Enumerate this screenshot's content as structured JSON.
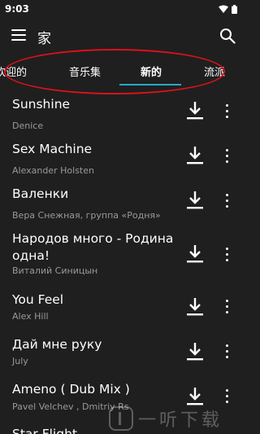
{
  "status_bar": {
    "time": "9:03"
  },
  "app_bar": {
    "title": "家"
  },
  "tabs": [
    {
      "label": "欢迎的"
    },
    {
      "label": "音乐集"
    },
    {
      "label": "新的"
    },
    {
      "label": "流派"
    }
  ],
  "active_tab": "新的",
  "songs": [
    {
      "title": "Sunshine",
      "artist": "Denice"
    },
    {
      "title": "Sex Machine",
      "artist": "Alexander Holsten"
    },
    {
      "title": "Валенки",
      "artist": "Вера Снежная, группа «Родня»"
    },
    {
      "title": "Народов много - Родина одна!",
      "artist": "Виталий Синицын"
    },
    {
      "title": "You Feel",
      "artist": "Alex Hill"
    },
    {
      "title": "Дай мне руку",
      "artist": "July"
    },
    {
      "title": "Ameno ( Dub Mix )",
      "artist": "Pavel Velchev , Dmitriy Rs"
    },
    {
      "title": "Star Flight",
      "artist": ""
    }
  ],
  "watermark": {
    "text": "一听下载"
  },
  "colors": {
    "background": "#1f1f1f",
    "accent": "#29a8c9",
    "highlight_outline": "#d9121c",
    "secondary_text": "#9a9a9a"
  }
}
